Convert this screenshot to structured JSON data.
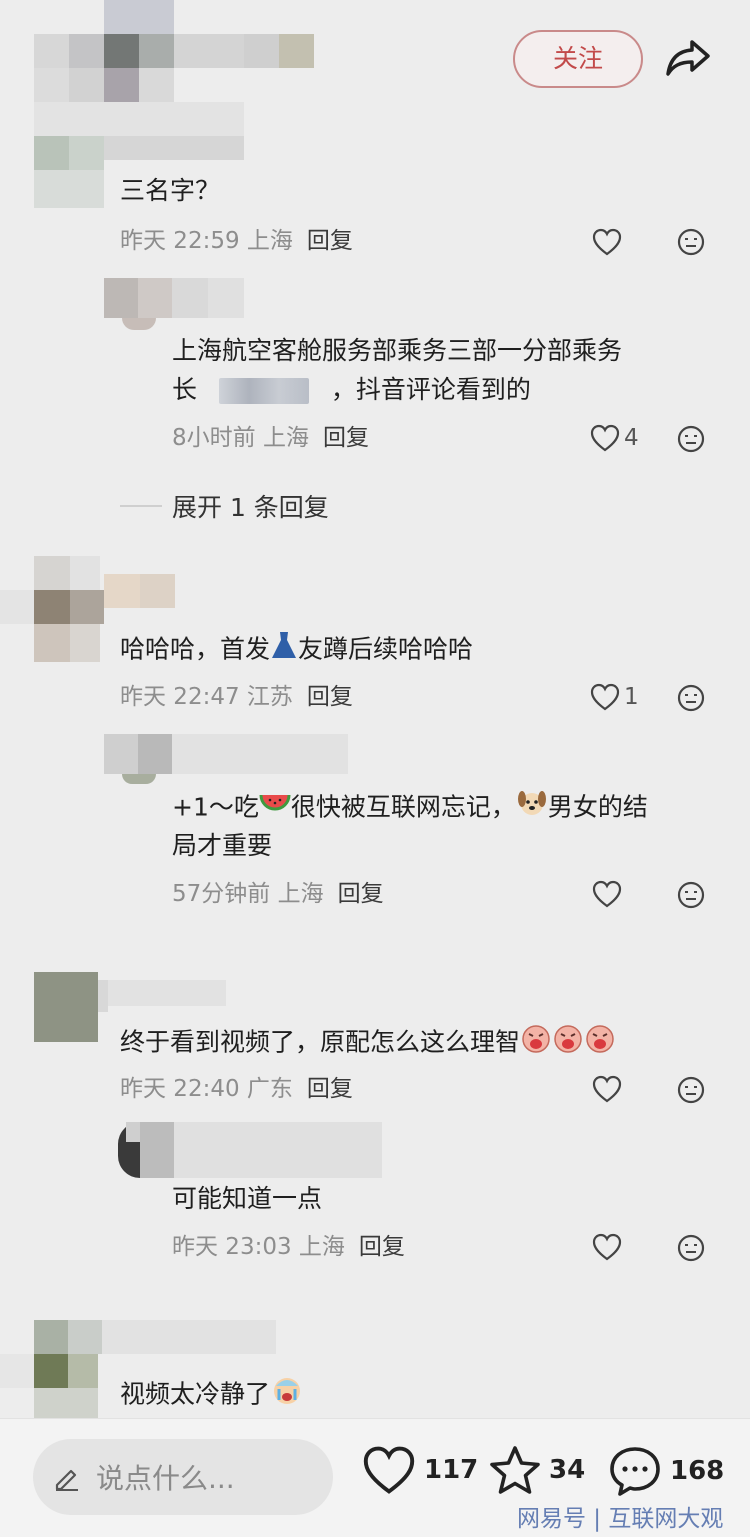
{
  "header": {
    "follow_label": "关注"
  },
  "comments": [
    {
      "text": "三名字？",
      "time": "昨天 22:59 上海",
      "reply": "回复",
      "likes": ""
    },
    {
      "text_line1": "上海航空客舱服务部乘务三部一分部乘务",
      "text_line2_prefix": "长",
      "text_line2_suffix": "，抖音评论看到的",
      "time": "8小时前 上海",
      "reply": "回复",
      "likes": "4"
    },
    {
      "text_prefix": "哈哈哈，首发",
      "text_suffix": "友蹲后续哈哈哈",
      "time": "昨天 22:47 江苏",
      "reply": "回复",
      "likes": "1"
    },
    {
      "text_line1_prefix": "+1～吃",
      "text_line1_mid": "很快被互联网忘记，",
      "text_line1_suffix": "男女的结",
      "text_line2": "局才重要",
      "time": "57分钟前 上海",
      "reply": "回复",
      "likes": ""
    },
    {
      "text": "终于看到视频了，原配怎么这么理智",
      "time": "昨天 22:40 广东",
      "reply": "回复",
      "likes": ""
    },
    {
      "text": "可能知道一点",
      "time": "昨天 23:03 上海",
      "reply": "回复",
      "likes": ""
    },
    {
      "text": "视频太冷静了",
      "time": "",
      "reply": "",
      "likes": ""
    }
  ],
  "expand_replies": "展开 1 条回复",
  "bottom": {
    "input_placeholder": "说点什么...",
    "likes": "117",
    "stars": "34",
    "comments": "168",
    "watermark": "网易号 | 互联网大观"
  },
  "colors": {
    "follow": "#c24a4a",
    "background": "#ededed",
    "watermark": "#4d6aa8"
  },
  "icons": [
    "share-icon",
    "heart-icon",
    "neutral-face-icon",
    "pen-icon",
    "star-icon",
    "chat-bubble-icon"
  ]
}
